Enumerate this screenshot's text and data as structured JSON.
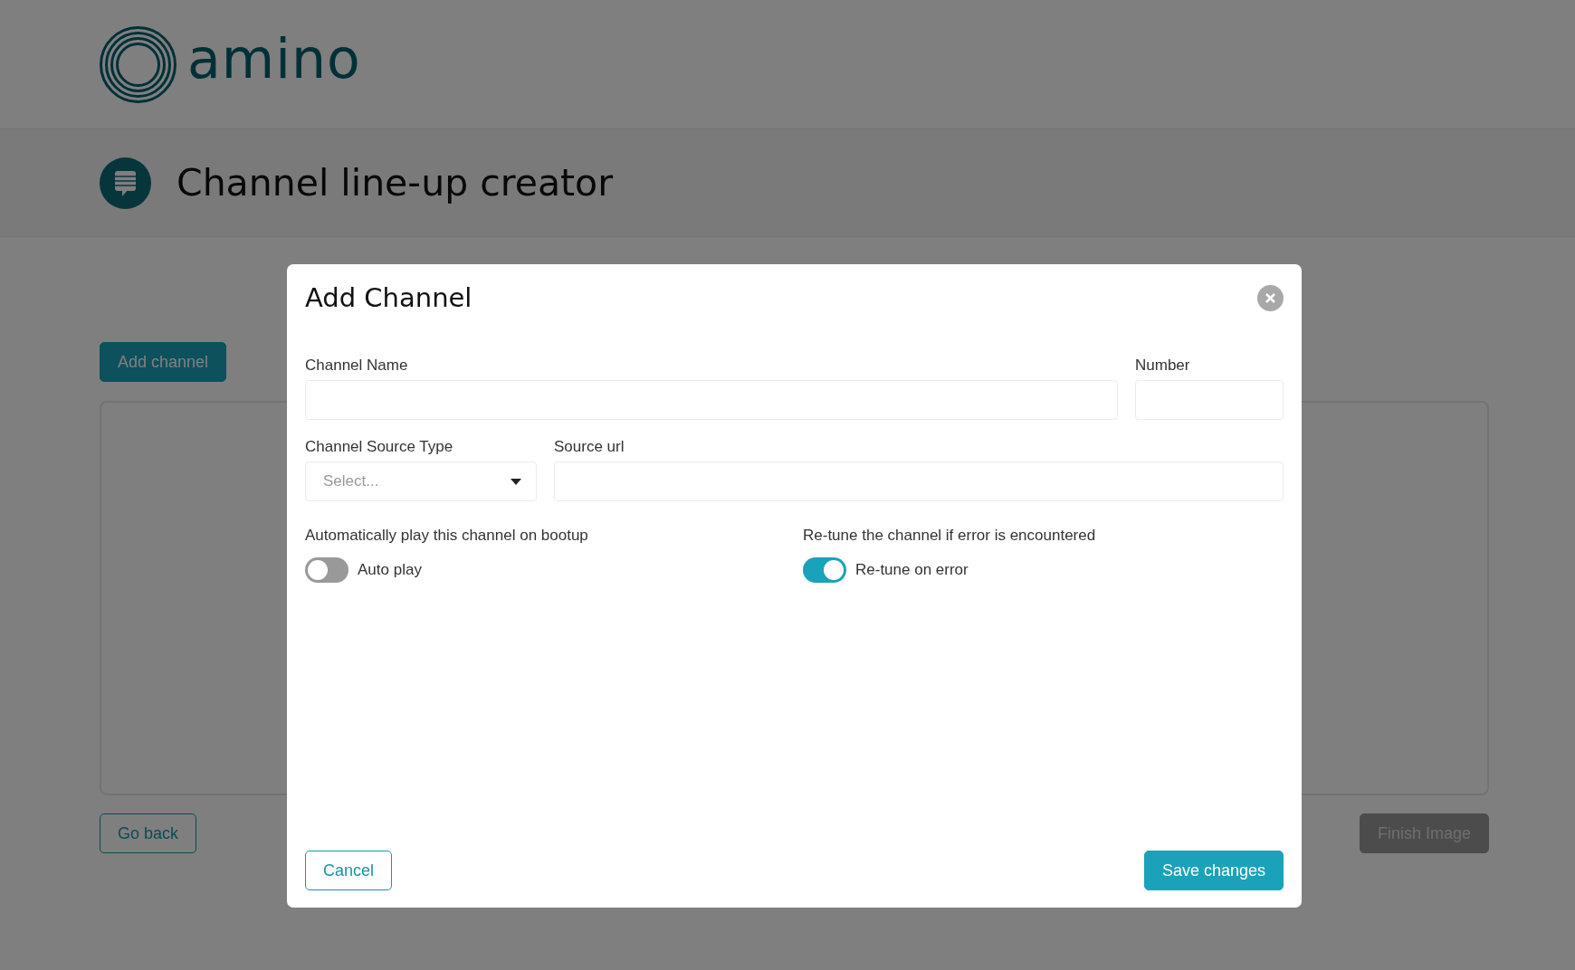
{
  "header": {
    "logo_text": "amino"
  },
  "page": {
    "title": "Channel line-up creator",
    "add_button": "Add channel",
    "back_button": "Go back",
    "finish_button": {
      "label": "Finish Image",
      "disabled": true
    }
  },
  "dialog": {
    "title": "Add Channel",
    "field_rows": [
      [
        {
          "kind": "text",
          "label": "Channel Name"
        },
        {
          "kind": "text",
          "label": "Number"
        }
      ],
      [
        {
          "kind": "select",
          "label": "Channel Source Type",
          "placeholder": "Select..."
        },
        {
          "kind": "text",
          "label": "Source url"
        }
      ]
    ],
    "toggles": [
      {
        "question": "Automatically play this channel on bootup",
        "label": "Auto play",
        "on": false
      },
      {
        "question": "Re-tune the channel if error is encountered",
        "label": "Re-tune on error",
        "on": true
      }
    ],
    "cancel_button": "Cancel",
    "save_button": "Save changes"
  }
}
